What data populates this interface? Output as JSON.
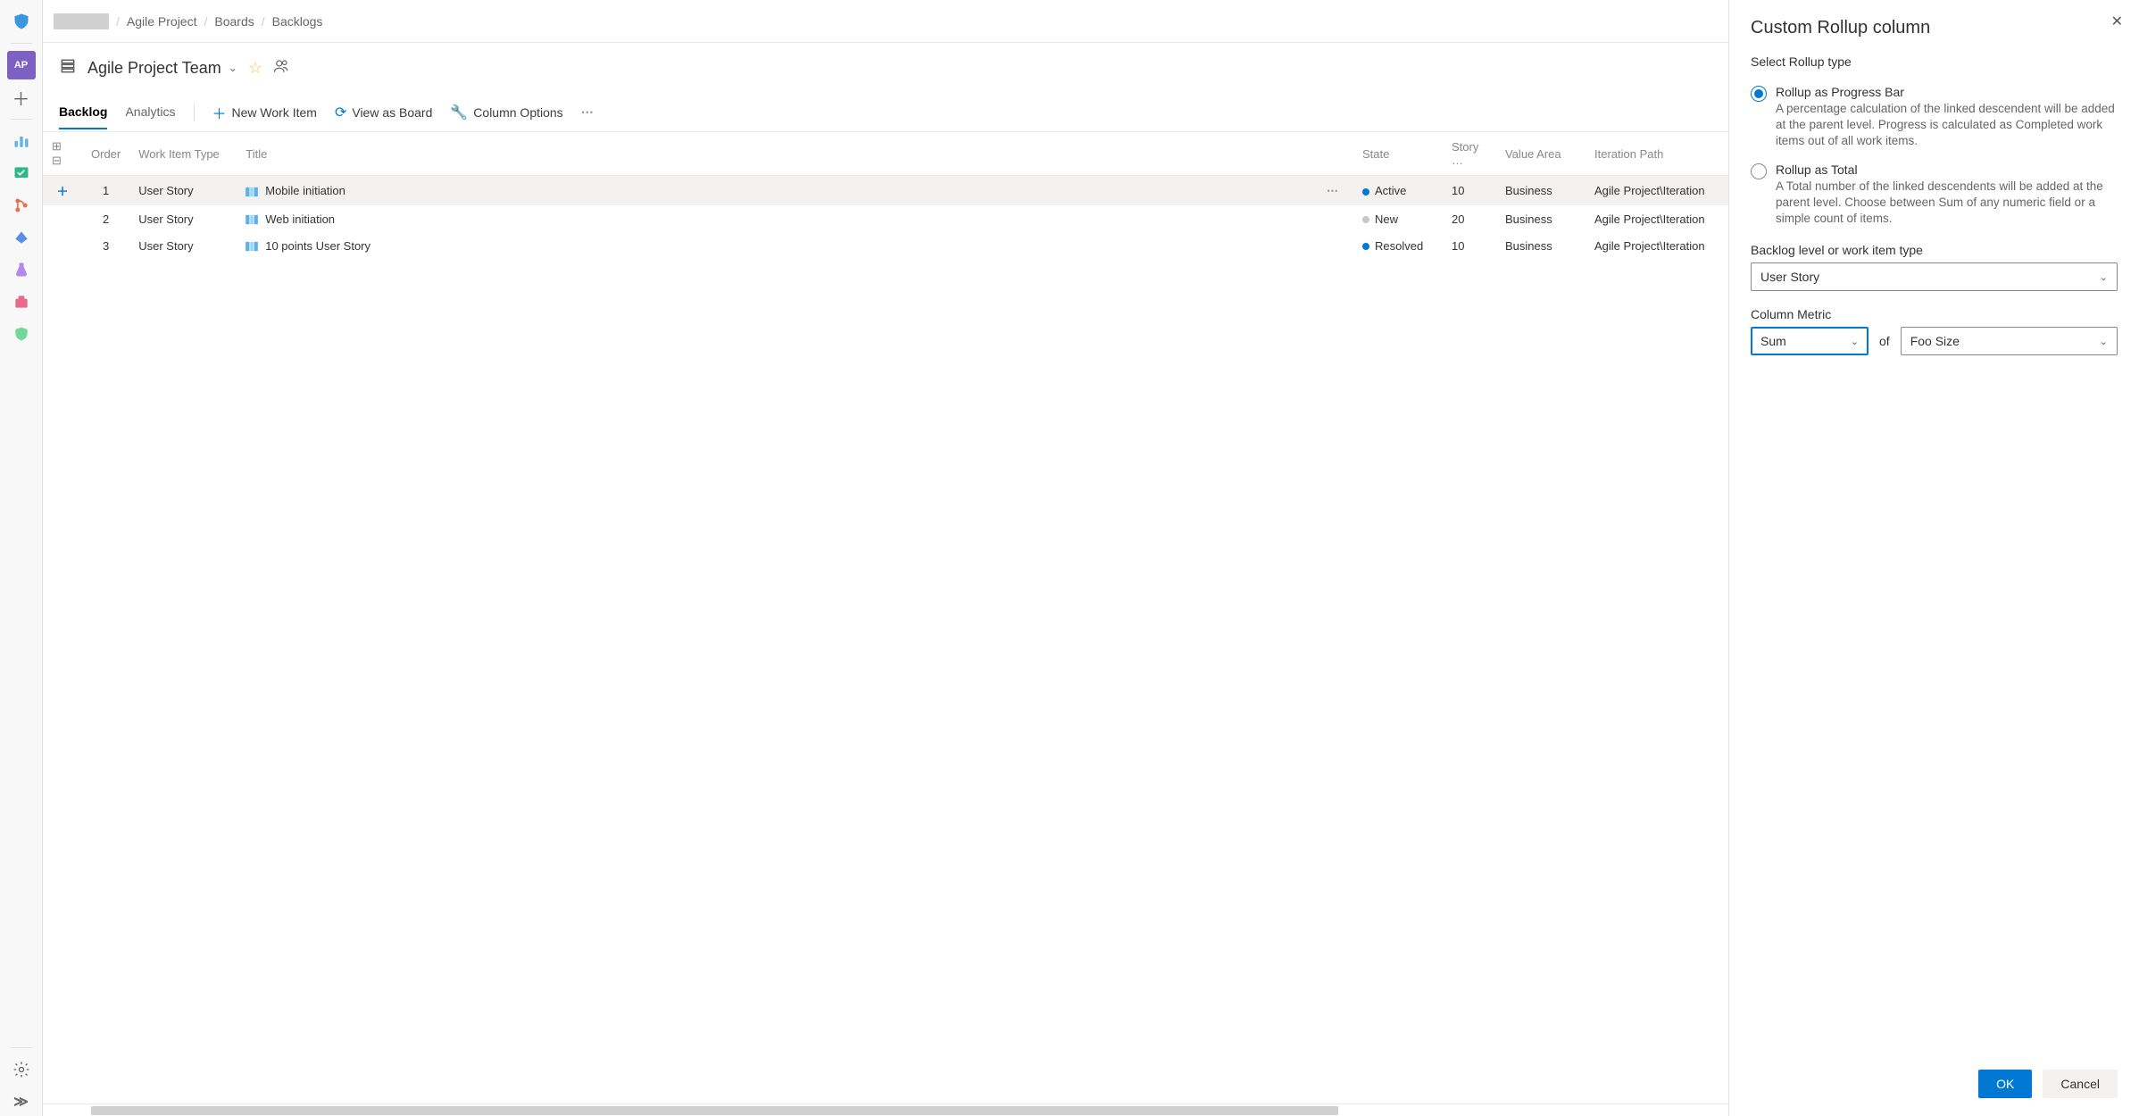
{
  "breadcrumb": {
    "project": "Agile Project",
    "section": "Boards",
    "page": "Backlogs"
  },
  "rail": {
    "project_initials": "AP"
  },
  "team_header": {
    "title": "Agile Project Team"
  },
  "tabs": {
    "backlog": "Backlog",
    "analytics": "Analytics"
  },
  "tools": {
    "new_item": "New Work Item",
    "view_board": "View as Board",
    "column_options": "Column Options"
  },
  "columns": {
    "order": "Order",
    "wit": "Work Item Type",
    "title": "Title",
    "state": "State",
    "story": "Story …",
    "value_area": "Value Area",
    "iteration": "Iteration Path"
  },
  "rows": [
    {
      "order": "1",
      "wit": "User Story",
      "title": "Mobile initiation",
      "state": "Active",
      "state_class": "dot-active",
      "story": "10",
      "value_area": "Business",
      "iteration": "Agile Project\\Iteration",
      "selected": true
    },
    {
      "order": "2",
      "wit": "User Story",
      "title": "Web initiation",
      "state": "New",
      "state_class": "dot-new",
      "story": "20",
      "value_area": "Business",
      "iteration": "Agile Project\\Iteration",
      "selected": false
    },
    {
      "order": "3",
      "wit": "User Story",
      "title": "10 points User Story",
      "state": "Resolved",
      "state_class": "dot-resolved",
      "story": "10",
      "value_area": "Business",
      "iteration": "Agile Project\\Iteration",
      "selected": false
    }
  ],
  "panel": {
    "title": "Custom Rollup column",
    "rollup_type_label": "Select Rollup type",
    "options": [
      {
        "title": "Rollup as Progress Bar",
        "desc": "A percentage calculation of the linked descendent will be added at the parent level. Progress is calculated as Completed work items out of all work items.",
        "selected": true
      },
      {
        "title": "Rollup as Total",
        "desc": "A Total number of the linked descendents will be added at the parent level. Choose between Sum of any numeric field or a simple count of items.",
        "selected": false
      }
    ],
    "backlog_level_label": "Backlog level or work item type",
    "backlog_level_value": "User Story",
    "column_metric_label": "Column Metric",
    "metric_aggregate": "Sum",
    "metric_of": "of",
    "metric_field": "Foo Size",
    "ok": "OK",
    "cancel": "Cancel"
  }
}
